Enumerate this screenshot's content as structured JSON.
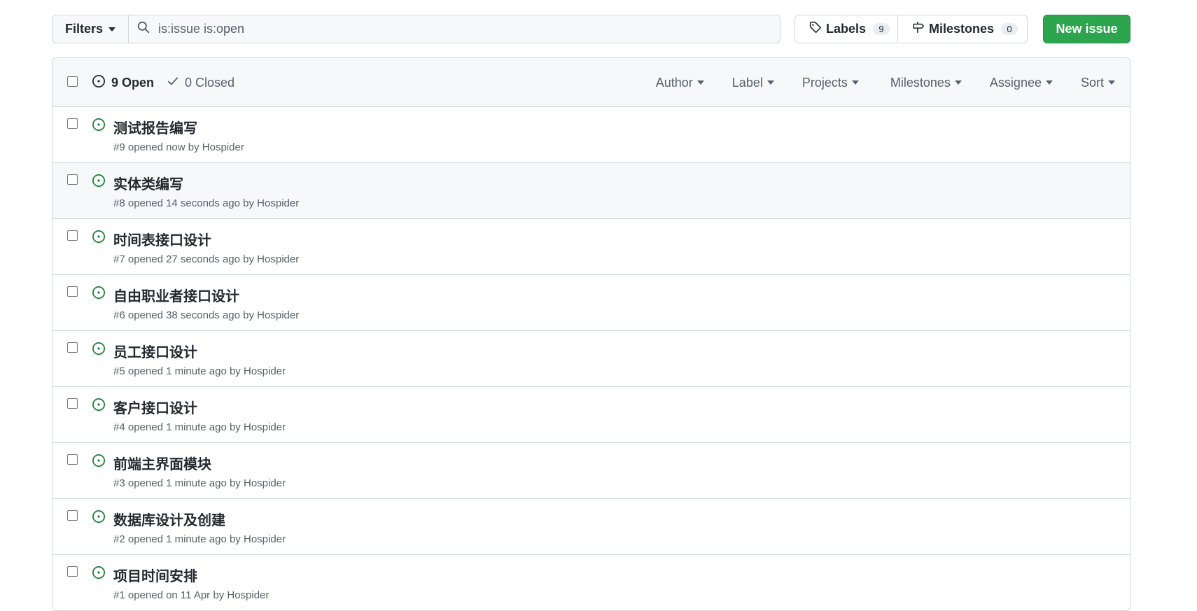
{
  "toolbar": {
    "filters_label": "Filters",
    "search_value": "is:issue is:open",
    "labels_label": "Labels",
    "labels_count": "9",
    "milestones_label": "Milestones",
    "milestones_count": "0",
    "new_issue_label": "New issue",
    "accent_color": "#2da44e"
  },
  "header": {
    "open_label": "9 Open",
    "closed_label": "0 Closed",
    "filters": [
      "Author",
      "Label",
      "Projects",
      "Milestones",
      "Assignee",
      "Sort"
    ]
  },
  "issues": [
    {
      "title": "测试报告编写",
      "meta": "#9 opened now by ",
      "author": "Hospider"
    },
    {
      "title": "实体类编写",
      "meta": "#8 opened 14 seconds ago by ",
      "author": "Hospider"
    },
    {
      "title": "时间表接口设计",
      "meta": "#7 opened 27 seconds ago by ",
      "author": "Hospider"
    },
    {
      "title": "自由职业者接口设计",
      "meta": "#6 opened 38 seconds ago by ",
      "author": "Hospider"
    },
    {
      "title": "员工接口设计",
      "meta": "#5 opened 1 minute ago by ",
      "author": "Hospider"
    },
    {
      "title": "客户接口设计",
      "meta": "#4 opened 1 minute ago by ",
      "author": "Hospider"
    },
    {
      "title": "前端主界面模块",
      "meta": "#3 opened 1 minute ago by ",
      "author": "Hospider"
    },
    {
      "title": "数据库设计及创建",
      "meta": "#2 opened 1 minute ago by ",
      "author": "Hospider"
    },
    {
      "title": "项目时间安排",
      "meta": "#1 opened on 11 Apr by ",
      "author": "Hospider"
    }
  ]
}
